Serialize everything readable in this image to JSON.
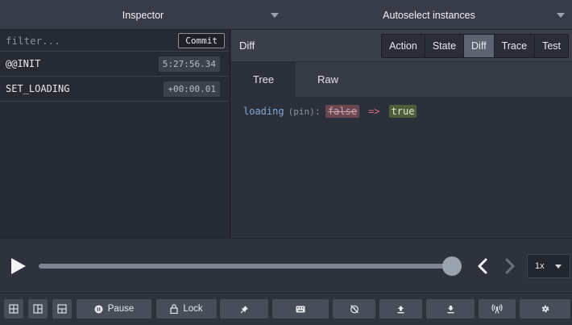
{
  "header": {
    "inspector_label": "Inspector",
    "instances_label": "Autoselect instances"
  },
  "actions_panel": {
    "filter_placeholder": "filter...",
    "commit_label": "Commit",
    "items": [
      {
        "name": "@@INIT",
        "time": "5:27:56.34"
      },
      {
        "name": "SET_LOADING",
        "time": "+00:00.01"
      }
    ]
  },
  "monitor": {
    "title": "Diff",
    "tabs": [
      "Action",
      "State",
      "Diff",
      "Trace",
      "Test"
    ],
    "active_tab": "Diff",
    "sub_tabs": [
      "Tree",
      "Raw"
    ],
    "active_sub_tab": "Tree",
    "diff": {
      "key": "loading",
      "annotation": "(pin)",
      "separator": ":",
      "old_value": "false",
      "arrow": "=>",
      "new_value": "true"
    }
  },
  "slider": {
    "speed": "1x",
    "position_fraction": 1.0
  },
  "toolbar": {
    "pause_label": "Pause",
    "lock_label": "Lock"
  },
  "colors": {
    "diff_added": "#4f5d3a",
    "diff_removed": "#6b4850",
    "key": "#83a9d6",
    "arrow": "#d96f8c"
  }
}
